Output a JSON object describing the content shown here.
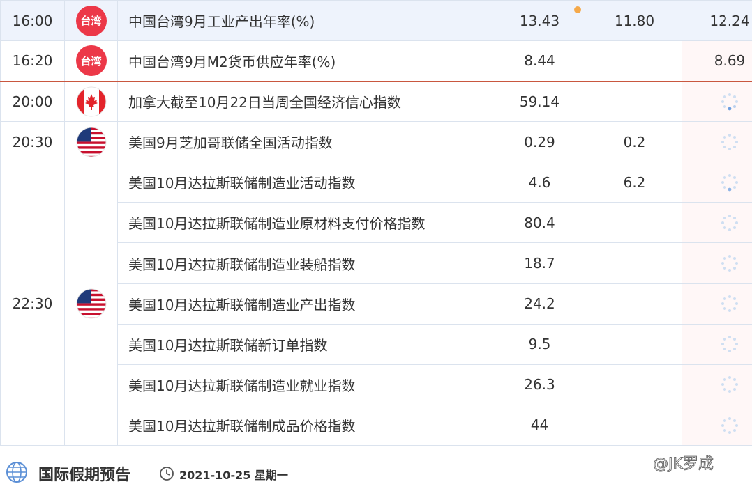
{
  "calendar": {
    "rows": [
      {
        "time": "16:00",
        "flag": "taiwan",
        "event": "中国台湾9月工业产出年率(%)",
        "prev": "13.43",
        "forecast": "11.80",
        "actual": "12.24"
      },
      {
        "time": "16:20",
        "flag": "taiwan",
        "event": "中国台湾9月M2货币供应年率(%)",
        "prev": "8.44",
        "forecast": "",
        "actual": "8.69"
      },
      {
        "time": "20:00",
        "flag": "canada",
        "event": "加拿大截至10月22日当周全国经济信心指数",
        "prev": "59.14",
        "forecast": "",
        "actual": ""
      },
      {
        "time": "20:30",
        "flag": "usa",
        "event": "美国9月芝加哥联储全国活动指数",
        "prev": "0.29",
        "forecast": "0.2",
        "actual": ""
      },
      {
        "time": "22:30",
        "flag": "usa",
        "event": "美国10月达拉斯联储制造业活动指数",
        "prev": "4.6",
        "forecast": "6.2",
        "actual": ""
      },
      {
        "time": "",
        "flag": "",
        "event": "美国10月达拉斯联储制造业原材料支付价格指数",
        "prev": "80.4",
        "forecast": "",
        "actual": ""
      },
      {
        "time": "",
        "flag": "",
        "event": "美国10月达拉斯联储制造业装船指数",
        "prev": "18.7",
        "forecast": "",
        "actual": ""
      },
      {
        "time": "",
        "flag": "",
        "event": "美国10月达拉斯联储制造业产出指数",
        "prev": "24.2",
        "forecast": "",
        "actual": ""
      },
      {
        "time": "",
        "flag": "",
        "event": "美国10月达拉斯联储新订单指数",
        "prev": "9.5",
        "forecast": "",
        "actual": ""
      },
      {
        "time": "",
        "flag": "",
        "event": "美国10月达拉斯联储制造业就业指数",
        "prev": "26.3",
        "forecast": "",
        "actual": ""
      },
      {
        "time": "",
        "flag": "",
        "event": "美国10月达拉斯联储制成品价格指数",
        "prev": "44",
        "forecast": "",
        "actual": ""
      }
    ],
    "taiwan_badge": "台湾"
  },
  "footer": {
    "title": "国际假期预告",
    "date": "2021-10-25 星期一",
    "watermark": "@JK罗成"
  },
  "colors": {
    "highlight_row": "#eef3fc",
    "separator": "#c9573f",
    "taiwan_badge": "#ec3848",
    "new_dot": "#f5a94a",
    "actual_bg": "#fff7f7"
  },
  "icons": {
    "flag_taiwan": "taiwan-badge-icon",
    "flag_canada": "canada-flag-icon",
    "flag_usa": "usa-flag-icon",
    "loading": "loading-spinner-icon",
    "globe": "globe-icon",
    "clock": "clock-icon"
  }
}
